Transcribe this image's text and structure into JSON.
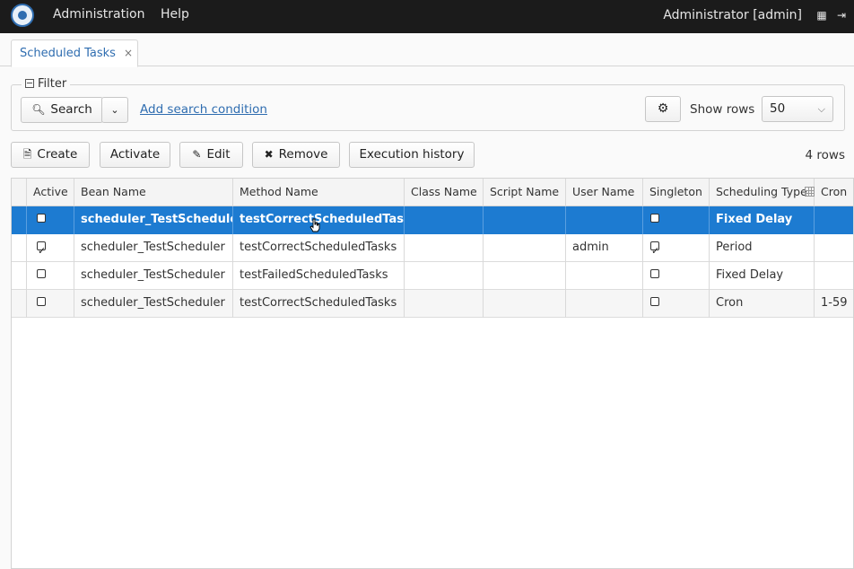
{
  "topbar": {
    "menu": [
      "Administration",
      "Help"
    ],
    "user": "Administrator [admin]"
  },
  "tab": {
    "label": "Scheduled Tasks",
    "close": "×"
  },
  "filter": {
    "legend": "Filter",
    "search_label": "Search",
    "add_condition": "Add search condition",
    "show_rows_label": "Show rows",
    "show_rows_value": "50"
  },
  "toolbar": {
    "create": "Create",
    "activate": "Activate",
    "edit": "Edit",
    "remove": "Remove",
    "history": "Execution history",
    "rows_count": "4 rows"
  },
  "table": {
    "columns": [
      "Active",
      "Bean Name",
      "Method Name",
      "Class Name",
      "Script Name",
      "User Name",
      "Singleton",
      "Scheduling Type",
      "Cron"
    ],
    "rows": [
      {
        "active": false,
        "bean": "scheduler_TestScheduler",
        "method": "testCorrectScheduledTasks",
        "cls": "",
        "script": "",
        "user": "",
        "singleton": false,
        "type": "Fixed Delay",
        "cron": ""
      },
      {
        "active": true,
        "bean": "scheduler_TestScheduler",
        "method": "testCorrectScheduledTasks",
        "cls": "",
        "script": "",
        "user": "admin",
        "singleton": true,
        "type": "Period",
        "cron": ""
      },
      {
        "active": false,
        "bean": "scheduler_TestScheduler",
        "method": "testFailedScheduledTasks",
        "cls": "",
        "script": "",
        "user": "",
        "singleton": false,
        "type": "Fixed Delay",
        "cron": ""
      },
      {
        "active": false,
        "bean": "scheduler_TestScheduler",
        "method": "testCorrectScheduledTasks",
        "cls": "",
        "script": "",
        "user": "",
        "singleton": false,
        "type": "Cron",
        "cron": "1-59"
      }
    ]
  }
}
